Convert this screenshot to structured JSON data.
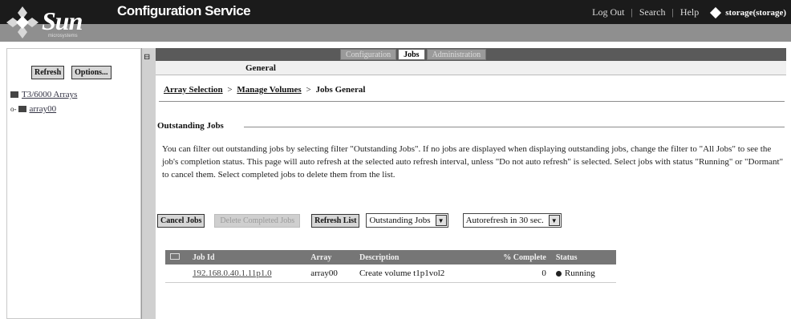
{
  "banner": {
    "logo_text": "Sun",
    "logo_sub": "microsystems",
    "app_title": "Configuration Service",
    "links": [
      "Log Out",
      "Search",
      "Help"
    ],
    "user": "storage(storage)"
  },
  "left": {
    "refresh_label": "Refresh",
    "options_label": "Options...",
    "tree": [
      {
        "label": "T3/6000 Arrays"
      },
      {
        "label": "array00"
      }
    ]
  },
  "tabs": [
    {
      "label": "Configuration",
      "active": false
    },
    {
      "label": "Jobs",
      "active": true
    },
    {
      "label": "Administration",
      "active": false
    }
  ],
  "subtab": "General",
  "breadcrumb": {
    "items": [
      "Array Selection",
      "Manage Volumes",
      "Jobs General"
    ],
    "separator": ">"
  },
  "section": {
    "title": "Outstanding Jobs",
    "description": "You can filter out outstanding jobs by selecting filter \"Outstanding Jobs\". If no jobs are displayed when displaying outstanding jobs, change the filter to \"All Jobs\" to see the job's completion status. This page will auto refresh at the selected auto refresh interval, unless \"Do not auto refresh\" is selected. Select jobs with status \"Running\" or \"Dormant\" to cancel them. Select completed jobs to delete them from the list."
  },
  "controls": {
    "cancel_label": "Cancel Jobs",
    "delete_label": "Delete Completed Jobs",
    "refresh_list_label": "Refresh List",
    "filter_value": "Outstanding Jobs",
    "autorefresh_value": "Autorefresh in 30 sec."
  },
  "table": {
    "headers": [
      "Job Id",
      "Array",
      "Description",
      "% Complete",
      "Status"
    ],
    "rows": [
      {
        "job_id": "192.168.0.40.1.11p1.0",
        "array": "array00",
        "description": "Create volume t1p1vol2",
        "complete": "0",
        "status": "Running"
      }
    ]
  },
  "colors": {
    "banner": "#1b1b1b",
    "strip": "#8f8f8f",
    "header": "#767676"
  }
}
